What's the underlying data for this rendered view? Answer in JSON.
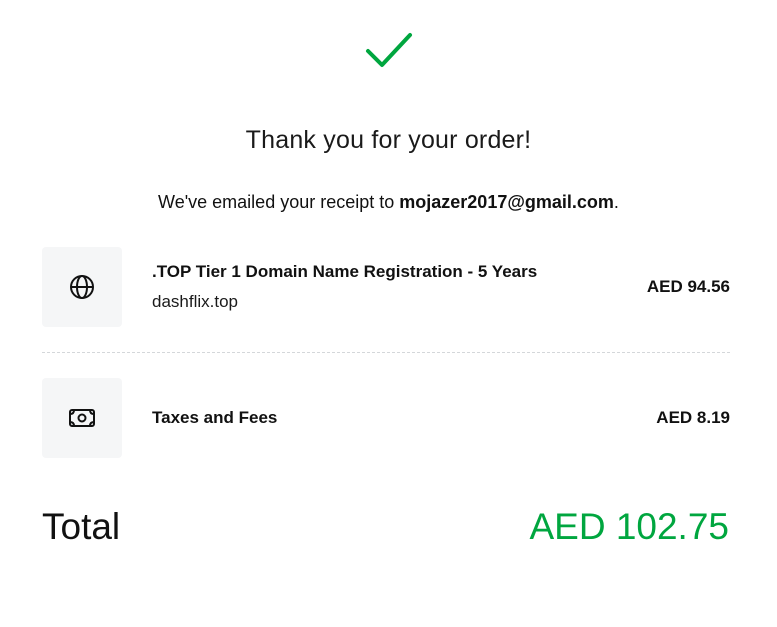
{
  "header": {
    "check_icon": "checkmark-icon",
    "check_color": "#00a63f",
    "title": "Thank you for your order!",
    "receipt_prefix": "We've emailed your receipt to ",
    "receipt_email": "mojazer2017@gmail.com",
    "receipt_suffix": "."
  },
  "items": [
    {
      "icon": "globe-icon",
      "title": ".TOP Tier 1 Domain Name Registration - 5 Years",
      "subtitle": "dashflix.top",
      "price": "AED 94.56"
    },
    {
      "icon": "cash-icon",
      "title": "Taxes and Fees",
      "price": "AED 8.19"
    }
  ],
  "total": {
    "label": "Total",
    "value": "AED 102.75",
    "color": "#00a63f"
  }
}
